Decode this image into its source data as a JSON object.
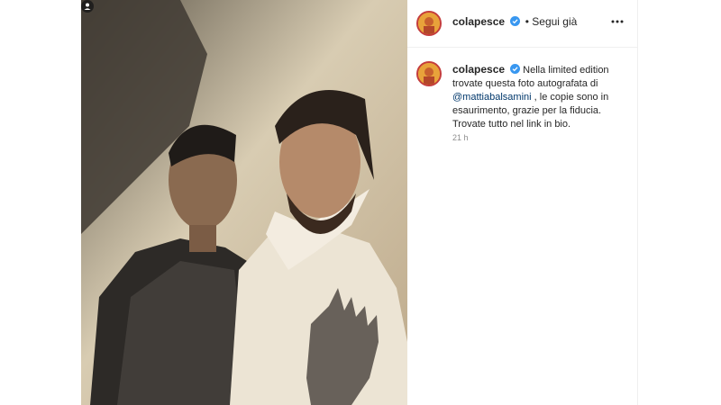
{
  "post": {
    "image_alt": "photo",
    "tag_icon": "person-tag-icon"
  },
  "header": {
    "username": "colapesce",
    "verified_icon": "verified-badge-icon",
    "follow_label": "• Segui già",
    "more_icon": "more-dots-icon"
  },
  "caption": {
    "username": "colapesce",
    "text_before": "Nella limited edition trovate questa foto autografata di",
    "mention": "@mattiabalsamini",
    "text_after": ", le copie sono in esaurimento, grazie per la fiducia. Trovate tutto nel link in bio.",
    "timestamp": "21 h"
  },
  "colors": {
    "accent_blue": "#3897f0",
    "mention": "#00376b",
    "muted": "#8e8e8e"
  }
}
